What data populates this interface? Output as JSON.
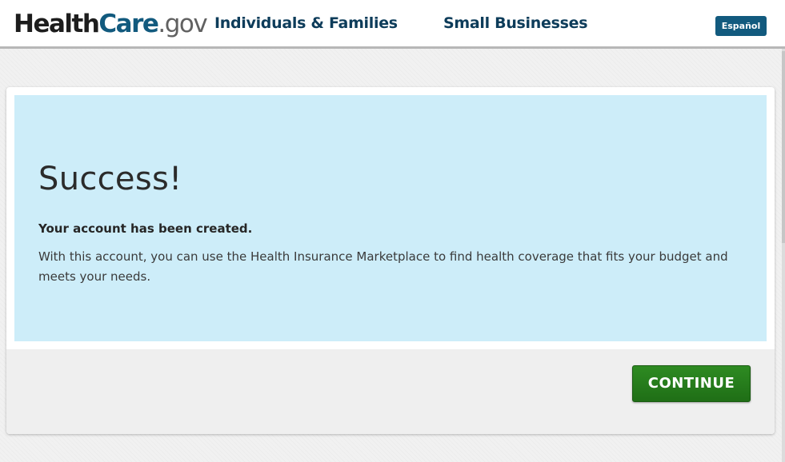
{
  "header": {
    "logo": {
      "health": "Health",
      "care": "Care",
      "gov": ".gov"
    },
    "nav": {
      "individuals_label": "Individuals & Families",
      "business_label": "Small Businesses"
    },
    "language_button_label": "Español"
  },
  "alert": {
    "title": "Success!",
    "subtitle": "Your account has been created.",
    "body": "With this account, you can use the Health Insurance Marketplace to find health coverage that fits your budget and meets your needs."
  },
  "actions": {
    "continue_label": "CONTINUE"
  },
  "colors": {
    "brand_blue": "#125a7e",
    "nav_text": "#0d3c5a",
    "alert_background": "#cdedf9",
    "continue_green": "#2e8b22"
  }
}
